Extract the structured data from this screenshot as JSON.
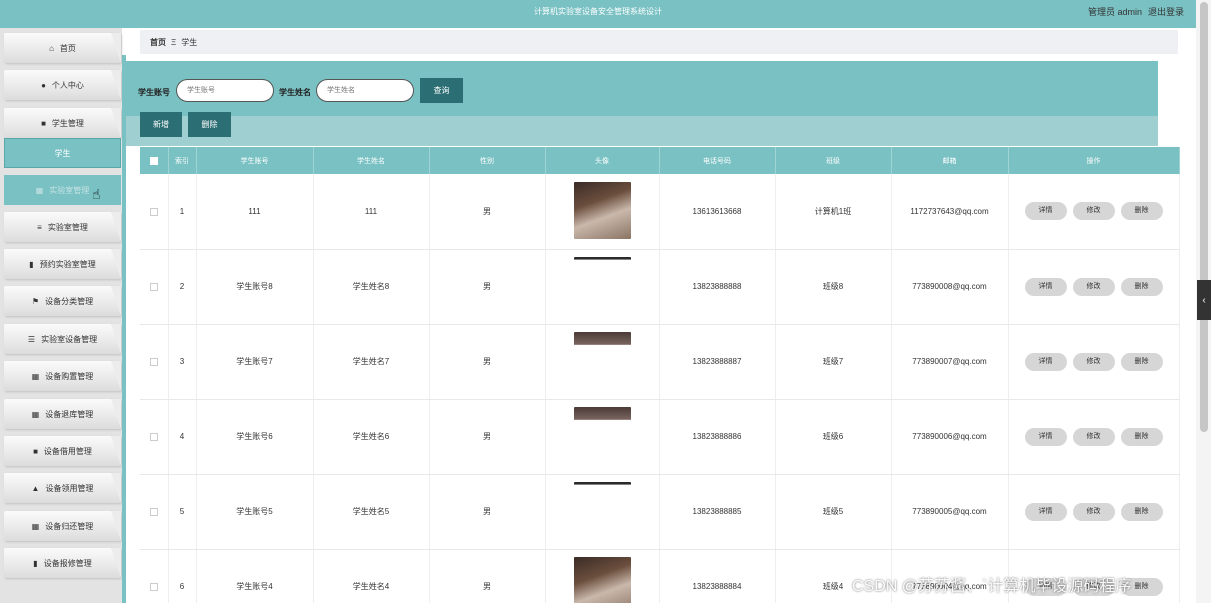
{
  "header": {
    "title": "计算机实验室设备安全管理系统设计",
    "user": "管理员 admin",
    "logout": "退出登录"
  },
  "sidebar": {
    "items": [
      {
        "icon": "home-icon",
        "glyph": "⌂",
        "label": "首页"
      },
      {
        "icon": "user-icon",
        "glyph": "●",
        "label": "个人中心"
      },
      {
        "icon": "student-icon",
        "glyph": "■",
        "label": "学生管理"
      },
      {
        "icon": "",
        "glyph": "",
        "label": "学生"
      },
      {
        "icon": "grid-icon",
        "glyph": "▦",
        "label": "实验室管理"
      },
      {
        "icon": "list-icon",
        "glyph": "≡",
        "label": "实验室管理"
      },
      {
        "icon": "clipboard-icon",
        "glyph": "▮",
        "label": "预约实验室管理"
      },
      {
        "icon": "flag-icon",
        "glyph": "⚑",
        "label": "设备分类管理"
      },
      {
        "icon": "sliders-icon",
        "glyph": "☰",
        "label": "实验室设备管理"
      },
      {
        "icon": "grid-icon",
        "glyph": "▦",
        "label": "设备购置管理"
      },
      {
        "icon": "grid-icon",
        "glyph": "▦",
        "label": "设备退库管理"
      },
      {
        "icon": "box-icon",
        "glyph": "■",
        "label": "设备借用管理"
      },
      {
        "icon": "inbox-icon",
        "glyph": "▲",
        "label": "设备领用管理"
      },
      {
        "icon": "grid-icon",
        "glyph": "▦",
        "label": "设备归还管理"
      },
      {
        "icon": "clipboard-icon",
        "glyph": "▮",
        "label": "设备报修管理"
      }
    ]
  },
  "breadcrumb": {
    "home": "首页",
    "separator": "Ξ",
    "current": "学生"
  },
  "search": {
    "account_label": "学生账号",
    "account_placeholder": "学生账号",
    "name_label": "学生姓名",
    "name_placeholder": "学生姓名",
    "query_button": "查询"
  },
  "actions": {
    "add": "新增",
    "delete": "删除"
  },
  "table": {
    "headers": [
      "索引",
      "学生账号",
      "学生姓名",
      "性别",
      "头像",
      "电话号码",
      "班级",
      "邮箱",
      "操作"
    ],
    "op_detail": "详情",
    "op_edit": "修改",
    "op_delete": "删除",
    "rows": [
      {
        "index": "1",
        "account": "111",
        "name": "111",
        "gender": "男",
        "phone": "13613613668",
        "class": "计算机1班",
        "email": "1172737643@qq.com",
        "avatar": "full"
      },
      {
        "index": "2",
        "account": "学生账号8",
        "name": "学生姓名8",
        "gender": "男",
        "phone": "13823888888",
        "class": "班级8",
        "email": "773890008@qq.com",
        "avatar": "sliver"
      },
      {
        "index": "3",
        "account": "学生账号7",
        "name": "学生姓名7",
        "gender": "男",
        "phone": "13823888887",
        "class": "班级7",
        "email": "773890007@qq.com",
        "avatar": "partial"
      },
      {
        "index": "4",
        "account": "学生账号6",
        "name": "学生姓名6",
        "gender": "男",
        "phone": "13823888886",
        "class": "班级6",
        "email": "773890006@qq.com",
        "avatar": "partial"
      },
      {
        "index": "5",
        "account": "学生账号5",
        "name": "学生姓名5",
        "gender": "男",
        "phone": "13823888885",
        "class": "班级5",
        "email": "773890005@qq.com",
        "avatar": "sliver"
      },
      {
        "index": "6",
        "account": "学生账号4",
        "name": "学生姓名4",
        "gender": "男",
        "phone": "13823888884",
        "class": "班级4",
        "email": "773890004@qq.com",
        "avatar": "full"
      }
    ]
  },
  "watermark": "CSDN @苏苏酱、`计算机毕设源码程序",
  "colors": {
    "teal": "#7ac1c3",
    "dark_teal": "#2b6e74",
    "light_teal": "#9fcfd1"
  }
}
